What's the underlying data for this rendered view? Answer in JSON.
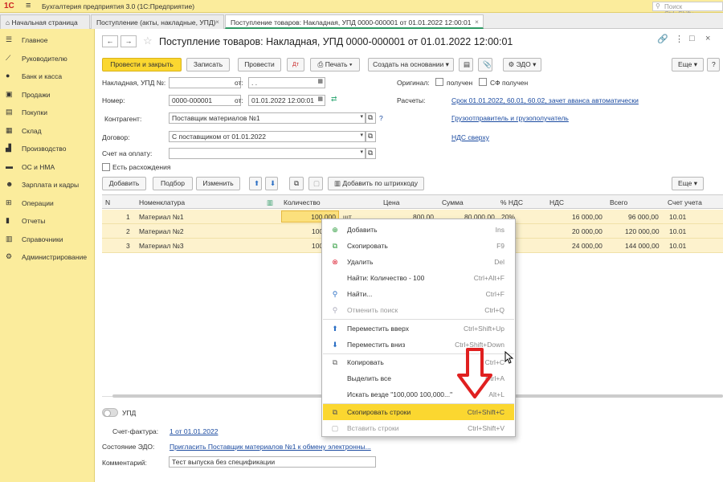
{
  "titlebar": {
    "logo": "1С",
    "app_title": "Бухгалтерия предприятия 3.0  (1С:Предприятие)",
    "search_placeholder": "Поиск Ctrl+Shift+"
  },
  "tabs": [
    {
      "label": "Начальная страница"
    },
    {
      "label": "Поступление (акты, накладные, УПД)"
    },
    {
      "label": "Поступление товаров: Накладная, УПД 0000-000001 от 01.01.2022 12:00:01"
    }
  ],
  "sidebar": {
    "items": [
      {
        "label": "Главное",
        "icon": "menu-icon"
      },
      {
        "label": "Руководителю",
        "icon": "chart-icon"
      },
      {
        "label": "Банк и касса",
        "icon": "bank-icon"
      },
      {
        "label": "Продажи",
        "icon": "sales-icon"
      },
      {
        "label": "Покупки",
        "icon": "purchase-icon"
      },
      {
        "label": "Склад",
        "icon": "warehouse-icon"
      },
      {
        "label": "Производство",
        "icon": "factory-icon"
      },
      {
        "label": "ОС и НМА",
        "icon": "assets-icon"
      },
      {
        "label": "Зарплата и кадры",
        "icon": "people-icon"
      },
      {
        "label": "Операции",
        "icon": "operations-icon"
      },
      {
        "label": "Отчеты",
        "icon": "reports-icon"
      },
      {
        "label": "Справочники",
        "icon": "book-icon"
      },
      {
        "label": "Администрирование",
        "icon": "gear-icon"
      }
    ]
  },
  "document": {
    "title": "Поступление товаров: Накладная, УПД 0000-000001 от 01.01.2022 12:00:01"
  },
  "toolbar": {
    "post_close": "Провести и закрыть",
    "save": "Записать",
    "post": "Провести",
    "print": "Печать",
    "create_based": "Создать на основании",
    "edo": "ЭДО"
  },
  "form": {
    "invoice_label": "Накладная, УПД №:",
    "invoice_value": "",
    "from_label": "от:",
    "invoice_date": " .  .",
    "number_label": "Номер:",
    "number_value": "0000-000001",
    "from_label2": "от:",
    "number_date": "01.01.2022 12:00:01",
    "contractor_label": "Контрагент:",
    "contractor_value": "Поставщик материалов №1",
    "help": "?",
    "contract_label": "Договор:",
    "contract_value": "С поставщиком от 01.01.2022",
    "payment_label": "Счет на оплату:",
    "payment_value": "",
    "discrepancy_label": "Есть расхождения",
    "original_label": "Оригинал:",
    "received_label": "получен",
    "sf_received_label": "СФ получен",
    "settlements_label": "Расчеты:",
    "settlements_link": "Срок 01.01.2022, 60.01, 60.02, зачет аванса автоматически",
    "consignor_link": "Грузоотправитель и грузополучатель",
    "vat_link": "НДС сверху"
  },
  "table_toolbar": {
    "add": "Добавить",
    "select": "Подбор",
    "change": "Изменить",
    "barcode": "Добавить по штрихкоду"
  },
  "table": {
    "columns": [
      "N",
      "Номенклатура",
      "Количество",
      "Цена",
      "Сумма",
      "% НДС",
      "НДС",
      "Всего",
      "Счет учета"
    ],
    "rows": [
      {
        "n": "1",
        "item": "Материал №1",
        "qty": "100,000",
        "unit": "шт",
        "price": "800,00",
        "sum": "80 000,00",
        "vat_rate": "20%",
        "vat": "16 000,00",
        "total": "96 000,00",
        "account": "10.01"
      },
      {
        "n": "2",
        "item": "Материал №2",
        "qty": "100",
        "unit": "",
        "price": "",
        "sum": "",
        "vat_rate": "",
        "vat": "20 000,00",
        "total": "120 000,00",
        "account": "10.01"
      },
      {
        "n": "3",
        "item": "Материал №3",
        "qty": "100",
        "unit": "",
        "price": "",
        "sum": "",
        "vat_rate": "",
        "vat": "24 000,00",
        "total": "144 000,00",
        "account": "10.01"
      }
    ]
  },
  "bottom": {
    "upd_label": "УПД",
    "invoice_label": "Счет-фактура:",
    "invoice_link": "1 от 01.01.2022",
    "edo_state_label": "Состояние ЭДО:",
    "edo_state_link": "Пригласить Поставщик материалов №1 к обмену электронны...",
    "comment_label": "Комментарий:",
    "comment_value": "Тест выпуска без спецификации"
  },
  "context_menu": {
    "items": [
      {
        "label": "Добавить",
        "shortcut": "Ins",
        "icon": "add-icon"
      },
      {
        "label": "Скопировать",
        "shortcut": "F9",
        "icon": "copy-icon"
      },
      {
        "label": "Удалить",
        "shortcut": "Del",
        "icon": "delete-icon"
      },
      {
        "label": "Найти: Количество - 100",
        "shortcut": "Ctrl+Alt+F",
        "icon": ""
      },
      {
        "label": "Найти...",
        "shortcut": "Ctrl+F",
        "icon": "find-icon"
      },
      {
        "label": "Отменить поиск",
        "shortcut": "Ctrl+Q",
        "icon": "cancel-search-icon"
      },
      {
        "label": "Переместить вверх",
        "shortcut": "Ctrl+Shift+Up",
        "icon": "arrow-up-icon"
      },
      {
        "label": "Переместить вниз",
        "shortcut": "Ctrl+Shift+Down",
        "icon": "arrow-down-icon"
      },
      {
        "label": "Копировать",
        "shortcut": "Ctrl+C",
        "icon": "clipboard-copy-icon"
      },
      {
        "label": "Выделить все",
        "shortcut": "Ctrl+A",
        "icon": ""
      },
      {
        "label": "Искать везде \"100,000 100,000...\"",
        "shortcut": "Alt+L",
        "icon": ""
      },
      {
        "label": "Скопировать строки",
        "shortcut": "Ctrl+Shift+C",
        "icon": "copy-rows-icon"
      },
      {
        "label": "Вставить строки",
        "shortcut": "Ctrl+Shift+V",
        "icon": "paste-rows-icon"
      }
    ]
  },
  "colors": {
    "accent": "#fbd730",
    "sidebar": "#fbec9c",
    "row": "#fdf2cd",
    "link": "#1a4aa0",
    "arrow": "#e02020"
  }
}
